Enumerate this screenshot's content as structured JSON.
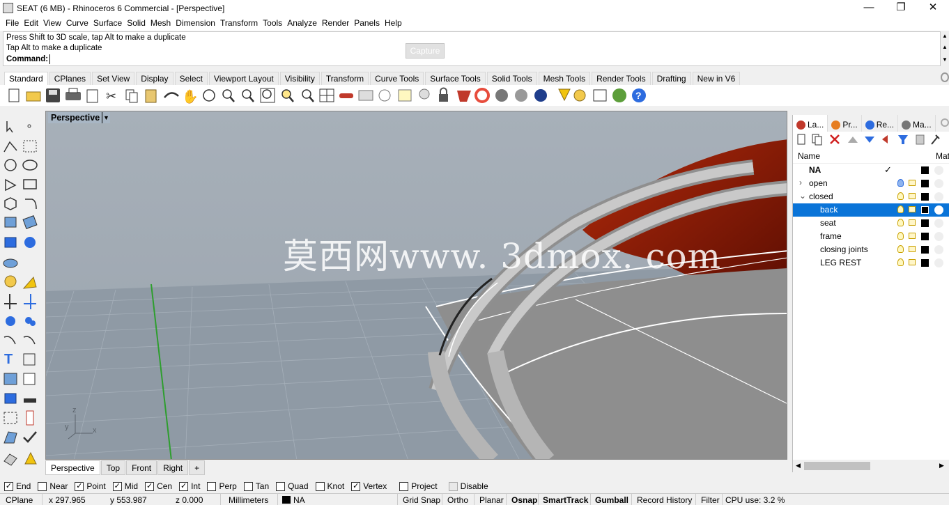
{
  "title": "SEAT (6 MB) - Rhinoceros 6 Commercial - [Perspective]",
  "window_controls": {
    "minimize": "—",
    "restore": "❐",
    "close": "✕"
  },
  "menu": [
    "File",
    "Edit",
    "View",
    "Curve",
    "Surface",
    "Solid",
    "Mesh",
    "Dimension",
    "Transform",
    "Tools",
    "Analyze",
    "Render",
    "Panels",
    "Help"
  ],
  "command": {
    "line1": "Press Shift to 3D scale, tap Alt to make a duplicate",
    "line2": "Tap Alt to make a duplicate",
    "prompt": "Command:",
    "capture_label": "Capture"
  },
  "toolbar_tabs": [
    "Standard",
    "CPlanes",
    "Set View",
    "Display",
    "Select",
    "Viewport Layout",
    "Visibility",
    "Transform",
    "Curve Tools",
    "Surface Tools",
    "Solid Tools",
    "Mesh Tools",
    "Render Tools",
    "Drafting",
    "New in V6"
  ],
  "viewport": {
    "title": "Perspective",
    "watermark": "莫西网www. 3dmox. com",
    "axis_labels": {
      "z": "z",
      "y": "y",
      "x": "x"
    },
    "tabs": [
      "Perspective",
      "Top",
      "Front",
      "Right"
    ],
    "add_tab": "+"
  },
  "panel": {
    "tabs": [
      {
        "label": "La...",
        "icon": "layers-icon"
      },
      {
        "label": "Pr...",
        "icon": "properties-icon"
      },
      {
        "label": "Re...",
        "icon": "render-icon"
      },
      {
        "label": "Ma...",
        "icon": "materials-icon"
      }
    ],
    "columns": {
      "name": "Name",
      "material": "Mat"
    },
    "layers": [
      {
        "name": "NA",
        "indent": 0,
        "current": true,
        "expander": ""
      },
      {
        "name": "open",
        "indent": 0,
        "expander": "›"
      },
      {
        "name": "closed",
        "indent": 0,
        "expander": "⌄"
      },
      {
        "name": "back",
        "indent": 1,
        "selected": true,
        "expander": ""
      },
      {
        "name": "seat",
        "indent": 1,
        "expander": ""
      },
      {
        "name": "frame",
        "indent": 1,
        "expander": ""
      },
      {
        "name": "closing joints",
        "indent": 1,
        "expander": ""
      },
      {
        "name": "LEG REST",
        "indent": 1,
        "expander": ""
      }
    ],
    "current_mark": "✓"
  },
  "osnaps": [
    {
      "label": "End",
      "checked": true
    },
    {
      "label": "Near",
      "checked": false
    },
    {
      "label": "Point",
      "checked": true
    },
    {
      "label": "Mid",
      "checked": true
    },
    {
      "label": "Cen",
      "checked": true
    },
    {
      "label": "Int",
      "checked": true
    },
    {
      "label": "Perp",
      "checked": false
    },
    {
      "label": "Tan",
      "checked": false
    },
    {
      "label": "Quad",
      "checked": false
    },
    {
      "label": "Knot",
      "checked": false
    },
    {
      "label": "Vertex",
      "checked": true
    },
    {
      "label": "Project",
      "checked": false
    },
    {
      "label": "Disable",
      "checked": false
    }
  ],
  "status": {
    "cplane": "CPlane",
    "x": "x 297.965",
    "y": "y 553.987",
    "z": "z 0.000",
    "units": "Millimeters",
    "layer": "NA",
    "grid_snap": "Grid Snap",
    "ortho": "Ortho",
    "planar": "Planar",
    "osnap": "Osnap",
    "smarttrack": "SmartTrack",
    "gumball": "Gumball",
    "record_history": "Record History",
    "filter": "Filter",
    "cpu": "CPU use: 3.2 %"
  },
  "colors": {
    "accent": "#0a74d8",
    "seat_red": "#9b1a05",
    "viewport_bg": "#9aa5b0",
    "grid_axis_green": "#2e9e2e"
  }
}
